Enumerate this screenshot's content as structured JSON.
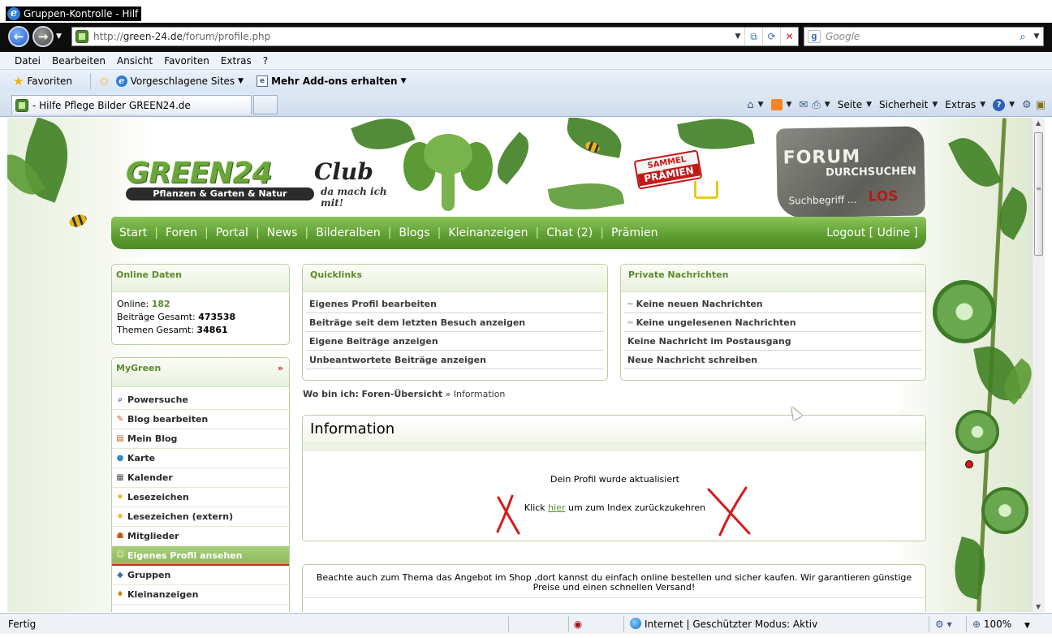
{
  "window": {
    "title": "Gruppen-Kontrolle - Hilf"
  },
  "address": {
    "url_prefix": "http://",
    "url_domain": "green-24.de",
    "url_path": "/forum/profile.php"
  },
  "search": {
    "placeholder": "Google"
  },
  "menu": [
    "Datei",
    "Bearbeiten",
    "Ansicht",
    "Favoriten",
    "Extras",
    "?"
  ],
  "favorites": {
    "label": "Favoriten",
    "suggested": "Vorgeschlagene Sites",
    "addons": "Mehr Add-ons erhalten"
  },
  "tab": {
    "title": "- Hilfe Pflege Bilder GREEN24.de"
  },
  "command_bar": {
    "seite": "Seite",
    "sicherheit": "Sicherheit",
    "extras": "Extras"
  },
  "header": {
    "logo_word": "GREEN24",
    "logo_club": "Club",
    "logo_tagline": "Pflanzen & Garten & Natur",
    "logo_slogan": "da mach ich mit!",
    "sammel_top": "SAMMEL",
    "sammel_big": "PRÄMIEN",
    "forum_line1": "FORUM",
    "forum_line2": "DURCHSUCHEN",
    "forum_search_placeholder": "Suchbegriff ...",
    "forum_search_button": "LOS"
  },
  "nav": {
    "items": [
      "Start",
      "Foren",
      "Portal",
      "News",
      "Bilderalben",
      "Blogs",
      "Kleinanzeigen",
      "Chat (2)",
      "Prämien"
    ],
    "logout": "Logout [ Udine ]"
  },
  "online": {
    "title": "Online Daten",
    "online_label": "Online:",
    "online_value": "182",
    "posts_label": "Beiträge Gesamt:",
    "posts_value": "473538",
    "topics_label": "Themen Gesamt:",
    "topics_value": "34861"
  },
  "mygreen": {
    "title": "MyGreen",
    "items": [
      "Powersuche",
      "Blog bearbeiten",
      "Mein Blog",
      "Karte",
      "Kalender",
      "Lesezeichen",
      "Lesezeichen (extern)",
      "Mitglieder",
      "Eigenes Profil ansehen",
      "Gruppen",
      "Kleinanzeigen"
    ],
    "active": "Eigenes Profil ansehen"
  },
  "quicklinks": {
    "title": "Quicklinks",
    "items": [
      "Eigenes Profil bearbeiten",
      "Beiträge seit dem letzten Besuch anzeigen",
      "Eigene Beiträge anzeigen",
      "Unbeantwortete Beiträge anzeigen"
    ]
  },
  "pm": {
    "title": "Private Nachrichten",
    "items": [
      "Keine neuen Nachrichten",
      "Keine ungelesenen Nachrichten",
      "Keine Nachricht im Postausgang",
      "Neue Nachricht schreiben"
    ]
  },
  "breadcrumb": {
    "label": "Wo bin ich:",
    "home": "Foren-Übersicht",
    "sep": "»",
    "current": "Information"
  },
  "info": {
    "title": "Information",
    "message": "Dein Profil wurde aktualisiert",
    "klick_before": "Klick",
    "klick_link": "hier",
    "klick_after": "um zum Index zurückzukehren"
  },
  "shop": {
    "text": "Beachte auch zum Thema das Angebot im Shop ,dort kannst du einfach online bestellen und sicher kaufen. Wir garantieren günstige Preise und einen schnellen Versand!"
  },
  "status": {
    "text": "Fertig",
    "zone": "Internet | Geschützter Modus: Aktiv",
    "zoom": "100%"
  },
  "colors": {
    "accent_green": "#5c8a2c",
    "nav_green": "#5d9d30",
    "annotation_red": "#d61a1a"
  }
}
